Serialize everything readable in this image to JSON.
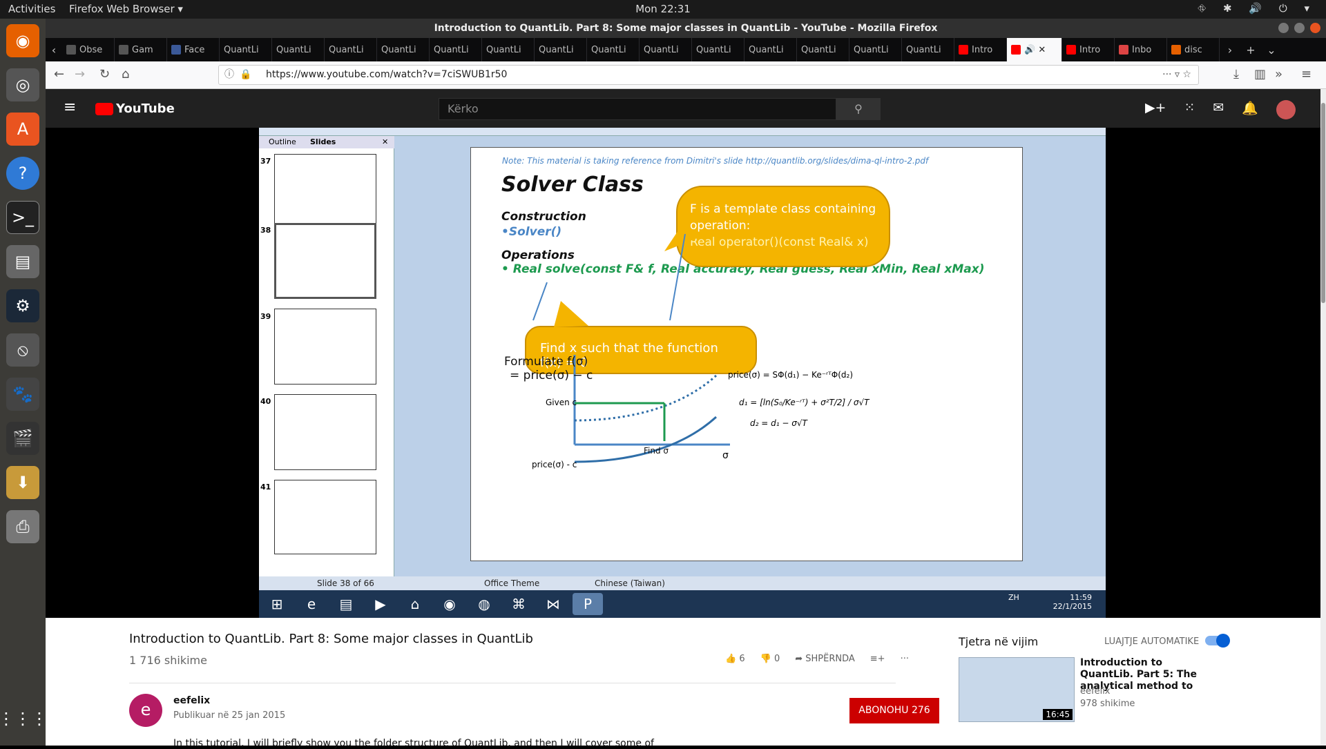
{
  "topbar": {
    "activities": "Activities",
    "app": "Firefox Web Browser ▾",
    "clock": "Mon 22:31",
    "tray": "⛗ ✱ 🔊 ⏻ ▾"
  },
  "window": {
    "title": "Introduction to QuantLib. Part 8: Some major classes in QuantLib - YouTube - Mozilla Firefox"
  },
  "tabs": [
    "Obse",
    "Gam",
    "Face",
    "QuantLi",
    "QuantLi",
    "QuantLi",
    "QuantLi",
    "QuantLi",
    "QuantLi",
    "QuantLi",
    "QuantLi",
    "QuantLi",
    "QuantLi",
    "QuantLi",
    "QuantLi",
    "QuantLi",
    "QuantLi",
    "Intro",
    "",
    "Intro",
    "Inbo",
    "disc"
  ],
  "url": "https://www.youtube.com/watch?v=7ciSWUB1r50",
  "yt": {
    "logo": "YouTube",
    "search_placeholder": "Kërko"
  },
  "ppt": {
    "panel_tabs": {
      "outline": "Outline",
      "slides": "Slides"
    },
    "thumbs": [
      {
        "num": "37"
      },
      {
        "num": "38"
      },
      {
        "num": "39"
      },
      {
        "num": "40"
      },
      {
        "num": "41"
      }
    ],
    "status": {
      "slide": "Slide 38 of 66",
      "theme": "Office Theme",
      "lang": "Chinese (Taiwan)"
    },
    "tray": {
      "lang": "ZH",
      "time": "11:59",
      "date": "22/1/2015"
    }
  },
  "slide": {
    "note": "Note: This material is taking reference from Dimitri's slide http://quantlib.org/slides/dima-ql-intro-2.pdf",
    "title": "Solver Class",
    "construction": "Construction",
    "solver_ctor": "•Solver()",
    "operations": "Operations",
    "solve_sig": "•    Real solve(const F& f, Real accuracy, Real guess, Real xMin, Real xMax)",
    "callout1_line1": "F is a template class containing operation:",
    "callout1_line2": "Real operator()(const Real& x)",
    "callout2": "Find x such that the function f(x) = 0",
    "formulate1": "Formulate f(σ)",
    "formulate2": "= price(σ) − c",
    "given_c": "Given c",
    "price_minus_c": "price(σ) - c",
    "find_sigma": "Find σ",
    "sigma_axis": "σ",
    "bs_price": "price(σ) = SΦ(d₁) − Ke⁻ʳᵀΦ(d₂)",
    "d1": "d₁ = [ln(S₀/Ke⁻ʳᵀ) + σ²T/2] / σ√T",
    "d2": "d₂ = d₁ − σ√T"
  },
  "video": {
    "title": "Introduction to QuantLib. Part 8: Some major classes in QuantLib",
    "views": "1 716 shikime",
    "likes": "6",
    "dislikes": "0",
    "share": "SHPËRNDA",
    "channel": "eefelix",
    "published": "Publikuar në 25 jan 2015",
    "subscribe": "ABONOHU",
    "subs": "276",
    "description": "In this tutorial, I will briefly show you the folder structure of QuantLib, and then I will cover some of"
  },
  "sidebar": {
    "next_label": "Tjetra në vijim",
    "autoplay": "LUAJTJE AUTOMATIKE",
    "rec_title": "Introduction to QuantLib. Part 5: The analytical method to",
    "rec_channel": "eefelix",
    "rec_views": "978 shikime",
    "rec_duration": "16:45"
  },
  "colors": {
    "accent_red": "#cc0000",
    "yt_blue": "#065fd4",
    "callout": "#f4b400",
    "green": "#1d9a4f",
    "blue": "#4a86c6"
  }
}
